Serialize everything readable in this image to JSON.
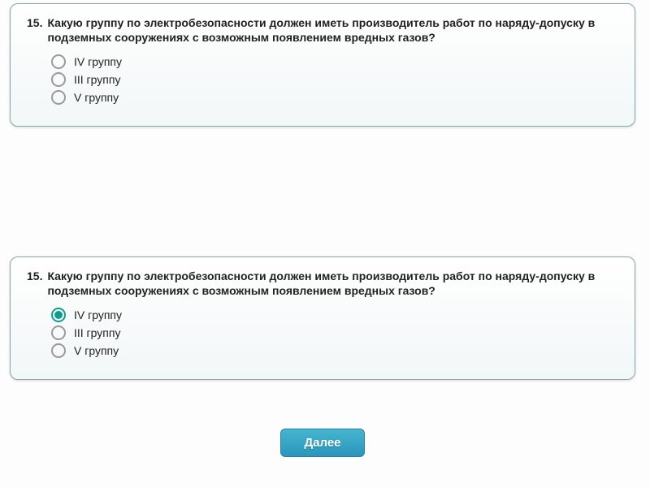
{
  "card1": {
    "number": "15.",
    "question": "Какую группу по электробезопасности должен иметь производитель работ по наряду-допуску в подземных сооружениях с возможным появлением вредных газов?",
    "options": [
      {
        "label": "IV группу",
        "selected": false
      },
      {
        "label": "III группу",
        "selected": false
      },
      {
        "label": "V группу",
        "selected": false
      }
    ]
  },
  "card2": {
    "number": "15.",
    "question": "Какую группу по электробезопасности должен иметь производитель работ по наряду-допуску в подземных сооружениях с возможным появлением вредных газов?",
    "options": [
      {
        "label": "IV группу",
        "selected": true
      },
      {
        "label": "III группу",
        "selected": false
      },
      {
        "label": "V группу",
        "selected": false
      }
    ]
  },
  "next_button": "Далее"
}
